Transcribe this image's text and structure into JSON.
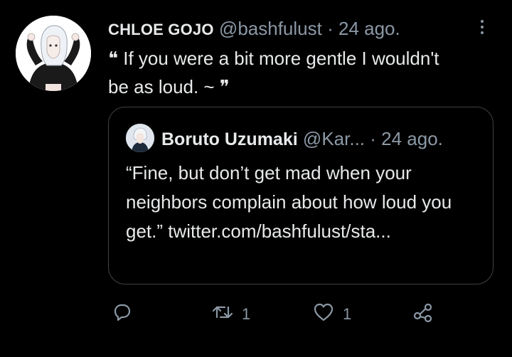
{
  "tweet": {
    "display_name": "CHLOE GOJO",
    "handle": "@bashfulust",
    "separator": "·",
    "time": "24 ago.",
    "text": "❝ If you were a bit more gentle I wouldn't be as loud. ~ ❞"
  },
  "quote": {
    "display_name": "Boruto Uzumaki",
    "handle": "@Kar...",
    "separator": "·",
    "time": "24 ago.",
    "text": "“Fine, but don’t get mad when your neighbors complain about how loud you get.” twitter.com/bashfulust/sta..."
  },
  "actions": {
    "reply_icon": "reply-icon",
    "retweet_icon": "retweet-icon",
    "retweet_count": "1",
    "like_icon": "heart-icon",
    "like_count": "1",
    "share_icon": "share-icon"
  },
  "colors": {
    "background": "#000000",
    "text": "#e7e9ea",
    "secondary": "#8b98a5",
    "border": "#3e4144"
  }
}
